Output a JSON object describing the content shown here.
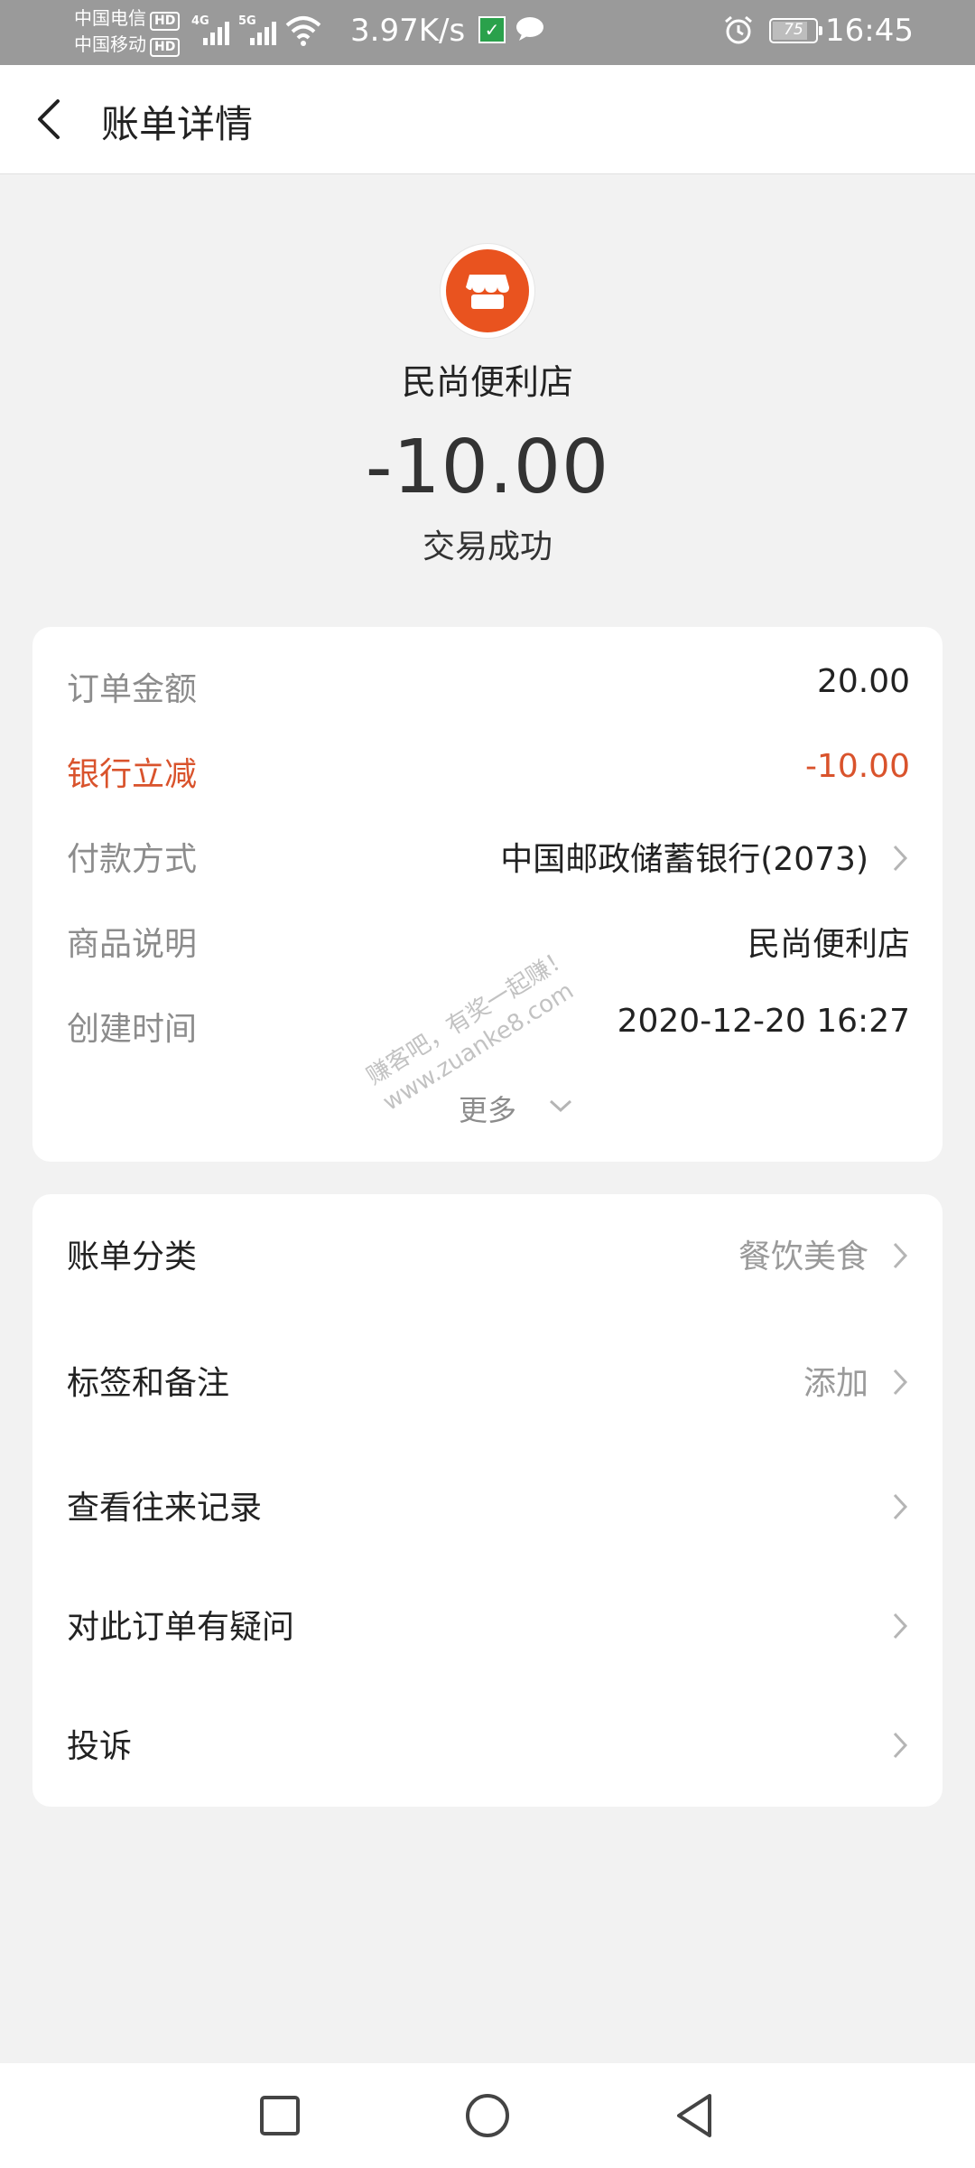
{
  "status_bar": {
    "carrier1": "中国电信",
    "carrier2": "中国移动",
    "hd": "HD",
    "net1": "4G",
    "net2": "5G",
    "speed": "3.97K/s",
    "battery": "75",
    "time": "16:45"
  },
  "nav": {
    "title": "账单详情"
  },
  "header": {
    "merchant_name": "民尚便利店",
    "amount": "-10.00",
    "status": "交易成功",
    "icon_color": "#e9531f"
  },
  "details": [
    {
      "label": "订单金额",
      "value": "20.00"
    },
    {
      "label": "银行立减",
      "value": "-10.00"
    },
    {
      "label": "付款方式",
      "value": "中国邮政储蓄银行(2073)"
    },
    {
      "label": "商品说明",
      "value": "民尚便利店"
    },
    {
      "label": "创建时间",
      "value": "2020-12-20 16:27"
    }
  ],
  "more_label": "更多",
  "menu": [
    {
      "label": "账单分类",
      "value": "餐饮美食"
    },
    {
      "label": "标签和备注",
      "value": "添加"
    },
    {
      "label": "查看往来记录",
      "value": ""
    },
    {
      "label": "对此订单有疑问",
      "value": ""
    },
    {
      "label": "投诉",
      "value": ""
    }
  ],
  "watermark": {
    "line1": "赚客吧，有奖一起赚！",
    "line2": "www.zuanke8.com"
  },
  "colors": {
    "accent_red": "#d9532c",
    "background": "#f2f2f2"
  }
}
